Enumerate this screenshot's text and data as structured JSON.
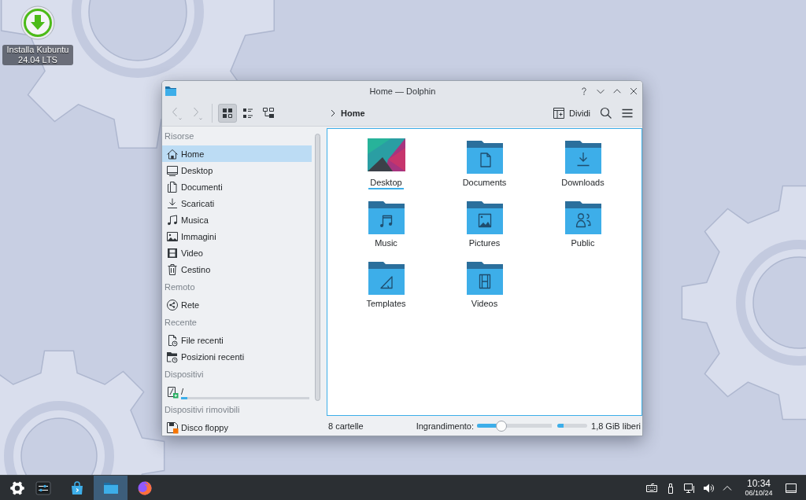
{
  "desktop": {
    "icons": [
      {
        "label": "Installa Kubuntu 24.04 LTS"
      }
    ]
  },
  "window": {
    "title": "Home — Dolphin"
  },
  "toolbar": {
    "back": {
      "disabled": true
    },
    "forward": {
      "disabled": true
    },
    "view_modes": [
      {
        "kind": "icons",
        "selected": true
      },
      {
        "kind": "compact",
        "selected": false
      },
      {
        "kind": "details",
        "selected": false
      }
    ],
    "breadcrumb": [
      {
        "label": "Home"
      }
    ],
    "split": {
      "label": "Dividi"
    }
  },
  "sidebar": {
    "sections": [
      {
        "title": "Risorse",
        "items": [
          {
            "kind": "home",
            "label": "Home",
            "selected": true
          },
          {
            "kind": "desktop",
            "label": "Desktop",
            "selected": false
          },
          {
            "kind": "documents",
            "label": "Documenti",
            "selected": false
          },
          {
            "kind": "downloads",
            "label": "Scaricati",
            "selected": false
          },
          {
            "kind": "music",
            "label": "Musica",
            "selected": false
          },
          {
            "kind": "pictures",
            "label": "Immagini",
            "selected": false
          },
          {
            "kind": "videos",
            "label": "Video",
            "selected": false
          },
          {
            "kind": "trash",
            "label": "Cestino",
            "selected": false
          }
        ]
      },
      {
        "title": "Remoto",
        "items": [
          {
            "kind": "network",
            "label": "Rete",
            "selected": false
          }
        ]
      },
      {
        "title": "Recente",
        "items": [
          {
            "kind": "recentfiles",
            "label": "File recenti",
            "selected": false
          },
          {
            "kind": "recentplaces",
            "label": "Posizioni recenti",
            "selected": false
          }
        ]
      },
      {
        "title": "Dispositivi",
        "items": [
          {
            "kind": "drive",
            "label": "/",
            "selected": false,
            "level": 0.05
          }
        ]
      },
      {
        "title": "Dispositivi rimovibili",
        "items": [
          {
            "kind": "floppy",
            "label": "Disco floppy",
            "selected": false
          }
        ]
      }
    ]
  },
  "files": {
    "items": [
      {
        "kind": "thumbnail",
        "name": "Desktop",
        "focused": true
      },
      {
        "kind": "documents",
        "name": "Documents",
        "focused": false
      },
      {
        "kind": "downloads",
        "name": "Downloads",
        "focused": false
      },
      {
        "kind": "music",
        "name": "Music",
        "focused": false
      },
      {
        "kind": "pictures",
        "name": "Pictures",
        "focused": false
      },
      {
        "kind": "public",
        "name": "Public",
        "focused": false
      },
      {
        "kind": "templates",
        "name": "Templates",
        "focused": false
      },
      {
        "kind": "videos",
        "name": "Videos",
        "focused": false
      }
    ]
  },
  "status_bar": {
    "summary": "8 cartelle",
    "zoom": {
      "label": "Ingrandimento:",
      "level": 0.3
    },
    "free_space": {
      "level": 0.2,
      "label": "1,8 GiB liberi"
    }
  },
  "taskbar": {
    "tasks": [
      {
        "kind": "launcher",
        "selected": false
      },
      {
        "kind": "settings",
        "selected": false
      },
      {
        "kind": "store",
        "selected": false
      },
      {
        "kind": "files",
        "selected": true
      },
      {
        "kind": "browser",
        "selected": false
      }
    ],
    "clock": {
      "time": "10:34",
      "date": "06/10/24"
    }
  }
}
